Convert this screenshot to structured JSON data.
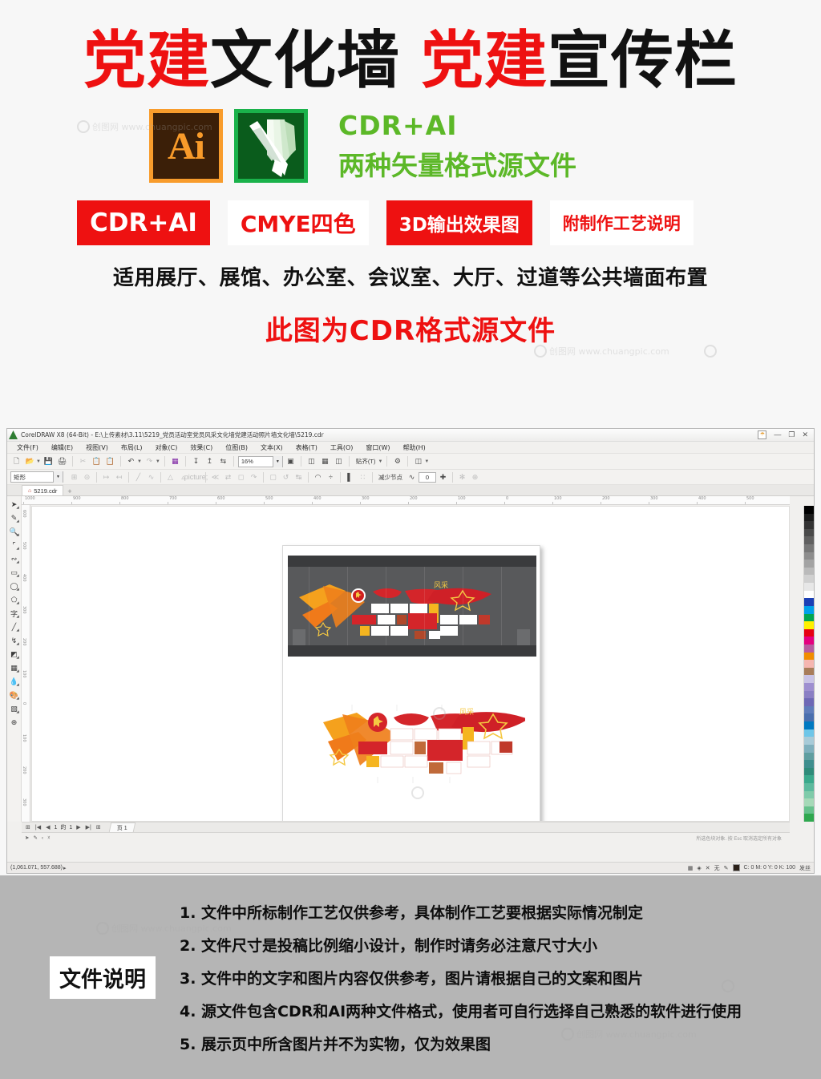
{
  "promo": {
    "title": {
      "seg1_red": "党建",
      "seg1_black": "文化墙",
      "seg2_red": "党建",
      "seg2_black": "宣传栏"
    },
    "icons": {
      "ai_label": "Ai",
      "cdr_name": "coreldraw-icon"
    },
    "format_heading": "CDR+AI",
    "format_sub": "两种矢量格式源文件",
    "badges": [
      {
        "label": "CDR+AI",
        "style": "red"
      },
      {
        "label": "CMYE四色",
        "style": "white"
      },
      {
        "label": "3D输出效果图",
        "style": "red"
      },
      {
        "label": "附制作工艺说明",
        "style": "white"
      }
    ],
    "usage_line": "适用展厅、展馆、办公室、会议室、大厅、过道等公共墙面布置",
    "cdr_note": "此图为CDR格式源文件",
    "watermark": "创图网 www.chuangpic.com",
    "colors": {
      "red": "#ee1111",
      "green": "#5cb828",
      "black": "#111111"
    }
  },
  "app": {
    "title": "CorelDRAW X8 (64-Bit) - E:\\上传素材\\3.11\\5219_党员活动室党员风采文化墙党建活动照片墙文化墙\\5219.cdr",
    "window_buttons": {
      "user": "用户",
      "minimize": "—",
      "restore": "❐",
      "close": "✕"
    },
    "menus": [
      "文件(F)",
      "编辑(E)",
      "视图(V)",
      "布局(L)",
      "对象(C)",
      "效果(C)",
      "位图(B)",
      "文本(X)",
      "表格(T)",
      "工具(O)",
      "窗口(W)",
      "帮助(H)"
    ],
    "toolbar": {
      "zoom_value": "16%",
      "snap_label": "贴齐(T)",
      "buttons": [
        "新建",
        "打开",
        "保存",
        "打印",
        "剪切",
        "复制",
        "粘贴",
        "撤销",
        "重做",
        "搜索内容",
        "导入",
        "导出",
        "发布为PDF",
        "缩放级别",
        "全屏预览",
        "显示标尺",
        "显示网格",
        "显示辅助线",
        "贴齐",
        "选项",
        "应用程序启动器"
      ]
    },
    "propbar": {
      "shape_type": "矩形",
      "reduce_nodes_label": "减少节点",
      "reduce_nodes_value": "0"
    },
    "doc_tab": {
      "name": "5219.cdr",
      "add": "+"
    },
    "ruler": {
      "h_ticks": [
        "1000",
        "900",
        "800",
        "700",
        "600",
        "500",
        "400",
        "300",
        "200",
        "100",
        "0",
        "100",
        "200",
        "300",
        "400",
        "500"
      ],
      "v_ticks": [
        "600",
        "500",
        "400",
        "300",
        "200",
        "100",
        "0",
        "100",
        "200",
        "300"
      ]
    },
    "tools": [
      {
        "name": "pick-tool",
        "glyph": "➤"
      },
      {
        "name": "shape-tool",
        "glyph": "✎"
      },
      {
        "name": "zoom-tool",
        "glyph": "🔍"
      },
      {
        "name": "crop-tool",
        "glyph": "⌗"
      },
      {
        "name": "freehand-tool",
        "glyph": "∿"
      },
      {
        "name": "rectangle-tool",
        "glyph": "▭"
      },
      {
        "name": "ellipse-tool",
        "glyph": "◯"
      },
      {
        "name": "polygon-tool",
        "glyph": "⬠"
      },
      {
        "name": "text-tool",
        "glyph": "字"
      },
      {
        "name": "dimension-tool",
        "glyph": "╱"
      },
      {
        "name": "connector-tool",
        "glyph": "⌁"
      },
      {
        "name": "dropshadow-tool",
        "glyph": "◩"
      },
      {
        "name": "transparency-tool",
        "glyph": "▦"
      },
      {
        "name": "eyedropper-tool",
        "glyph": "⚲"
      },
      {
        "name": "fill-tool",
        "glyph": "🖌"
      },
      {
        "name": "interactive-fill-tool",
        "glyph": "▧"
      },
      {
        "name": "smart-fill-tool",
        "glyph": "⊕"
      }
    ],
    "pagenav": {
      "first": "|◀",
      "prev": "◀",
      "current": "1",
      "of": "的",
      "total": "1",
      "next": "▶",
      "last": "▶|",
      "add_page": "⊞",
      "tab_label": "页 1"
    },
    "objectbar": {
      "hint": "所选色块对象. 按 Esc 取消选定所有对象"
    },
    "statusbar": {
      "coordinates": "(1,061.071, 557.688)",
      "fill_label": "无",
      "outline_color": "C: 0 M: 0 Y: 0 K: 100",
      "outline_width": "发丝"
    },
    "palette_colors": [
      "#000000",
      "#1c1c1c",
      "#333333",
      "#4a4a4a",
      "#606060",
      "#777777",
      "#8d8d8d",
      "#a3a3a3",
      "#bababa",
      "#d0d0d0",
      "#e7e7e7",
      "#ffffff",
      "#1b3fb5",
      "#00a0e9",
      "#00a650",
      "#fff100",
      "#e60012",
      "#e4007f",
      "#b85ba0",
      "#f18d00",
      "#f5b6b0",
      "#a87d5a",
      "#c9c3e6",
      "#9e8fd0",
      "#8a7fc4",
      "#6e68b5",
      "#5f7cba",
      "#4a6fae",
      "#0079c1",
      "#6ec6e8",
      "#a8cbd8",
      "#7fb0bd",
      "#5f9ea0",
      "#3e8e8e",
      "#2e8b7a",
      "#3aa98c",
      "#5cba9e",
      "#7fcbaa",
      "#a6d9b8",
      "#66c18c",
      "#2fa84f"
    ]
  },
  "footer": {
    "label": "文件说明",
    "notes": [
      "1. 文件中所标制作工艺仅供参考，具体制作工艺要根据实际情况制定",
      "2. 文件尺寸是投稿比例缩小设计，制作时请务必注意尺寸大小",
      "3. 文件中的文字和图片内容仅供参考，图片请根据自己的文案和图片",
      "4. 源文件包含CDR和AI两种文件格式，使用者可自行选择自己熟悉的软件进行使用",
      "5. 展示页中所含图片并不为实物，仅为效果图"
    ]
  }
}
